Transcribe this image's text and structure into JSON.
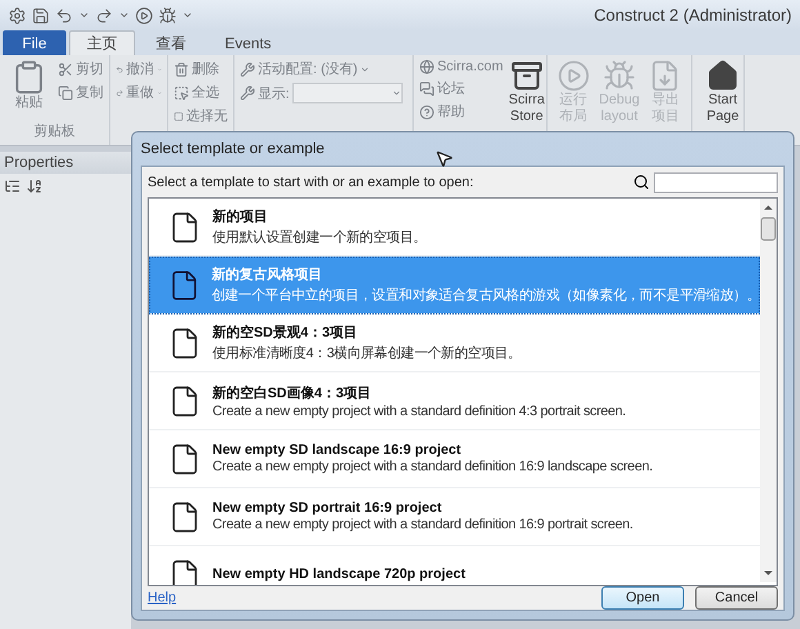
{
  "app": {
    "title": "Construct 2 (Administrator)",
    "tabs": [
      {
        "label": "File",
        "kind": "file",
        "selected": false
      },
      {
        "label": "主页",
        "kind": "tab",
        "selected": true
      },
      {
        "label": "查看",
        "kind": "tab",
        "selected": false
      },
      {
        "label": "Events",
        "kind": "tab",
        "selected": false
      }
    ],
    "ribbon": {
      "clipboard": {
        "paste": "粘贴",
        "cut": "剪切",
        "copy": "复制",
        "label": "剪贴板"
      },
      "history": {
        "undo": "撤消",
        "redo": "重做"
      },
      "selection": {
        "delete": "删除",
        "select_all": "全选",
        "select_none": "选择无"
      },
      "config": {
        "active_label": "活动配置:",
        "active_value": "(没有)",
        "display_label": "显示:"
      },
      "links": [
        "Scirra.com",
        "论坛",
        "帮助"
      ],
      "store": "Scirra Store",
      "preview": [
        {
          "label": "运行布局",
          "disabled": true
        },
        {
          "label": "Debug layout",
          "disabled": true
        },
        {
          "label": "导出项目",
          "disabled": true
        }
      ],
      "start_page": "Start Page"
    },
    "properties": {
      "title": "Properties"
    }
  },
  "dialog": {
    "title": "Select template or example",
    "instruction": "Select a template to start with or an example to open:",
    "templates": [
      {
        "title": "新的项目",
        "description": "使用默认设置创建一个新的空项目。",
        "selected": false
      },
      {
        "title": "新的复古风格项目",
        "description": "创建一个平台中立的项目，设置和对象适合复古风格的游戏（如像素化，而不是平滑缩放）。",
        "selected": true
      },
      {
        "title": "新的空SD景观4：3项目",
        "description": "使用标准清晰度4：3横向屏幕创建一个新的空项目。",
        "selected": false
      },
      {
        "title": "新的空白SD画像4：3项目",
        "description": "Create a new empty project with a standard definition 4:3 portrait screen.",
        "selected": false
      },
      {
        "title": "New empty SD landscape 16:9 project",
        "description": "Create a new empty project with a standard definition 16:9 landscape screen.",
        "selected": false
      },
      {
        "title": "New empty SD portrait 16:9 project",
        "description": "Create a new empty project with a standard definition 16:9 portrait screen.",
        "selected": false
      },
      {
        "title": "New empty HD landscape 720p project",
        "selected": false
      }
    ],
    "help": "Help",
    "buttons": [
      {
        "label": "Open",
        "default": true
      },
      {
        "label": "Cancel",
        "default": false
      }
    ]
  }
}
